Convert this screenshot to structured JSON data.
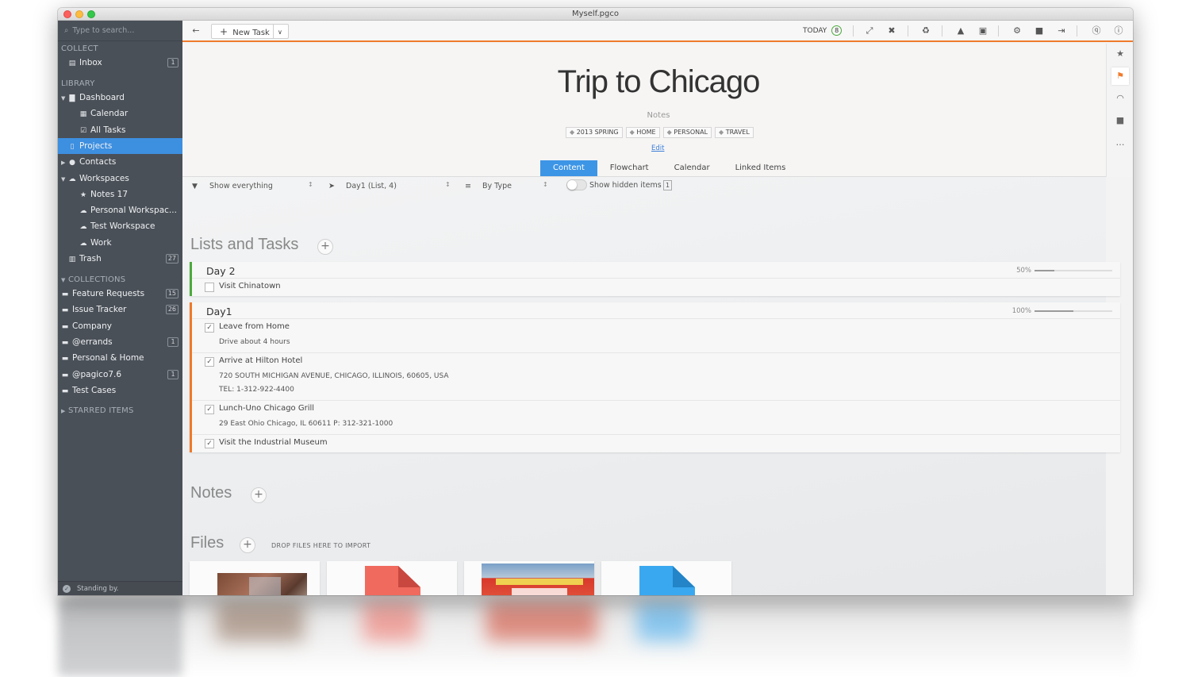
{
  "window": {
    "title": "Myself.pgco"
  },
  "sidebar": {
    "search_placeholder": "Type to search...",
    "collect_header": "COLLECT",
    "library_header": "LIBRARY",
    "collections_header": "COLLECTIONS",
    "starred_header": "STARRED ITEMS",
    "inbox": {
      "label": "Inbox",
      "count": "1"
    },
    "dashboard": "Dashboard",
    "calendar": "Calendar",
    "all_tasks": "All Tasks",
    "projects": "Projects",
    "contacts": "Contacts",
    "workspaces": "Workspaces",
    "notes17": "Notes 17",
    "personal_ws": "Personal Workspac...",
    "test_ws": "Test Workspace",
    "work": "Work",
    "trash": {
      "label": "Trash",
      "count": "27"
    },
    "collections": [
      {
        "label": "Feature Requests",
        "count": "15"
      },
      {
        "label": "Issue Tracker",
        "count": "26"
      },
      {
        "label": "Company",
        "count": ""
      },
      {
        "label": "@errands",
        "count": "1"
      },
      {
        "label": "Personal & Home",
        "count": ""
      },
      {
        "label": "@pagico7.6",
        "count": "1"
      },
      {
        "label": "Test Cases",
        "count": ""
      }
    ],
    "status": "Standing by."
  },
  "toolbar": {
    "new_task": "New Task",
    "today_label": "TODAY",
    "today_count": "8"
  },
  "project": {
    "title": "Trip to Chicago",
    "notes_label": "Notes",
    "tags": [
      "2013 SPRING",
      "HOME",
      "PERSONAL",
      "TRAVEL"
    ],
    "edit": "Edit",
    "tabs": [
      "Content",
      "Flowchart",
      "Calendar",
      "Linked Items"
    ]
  },
  "filters": {
    "show": "Show everything",
    "focus": "Day1 (List, 4)",
    "sort": "By Type",
    "hidden": "Show hidden items",
    "hidden_count": "1"
  },
  "sections": {
    "lists": "Lists and Tasks",
    "notes": "Notes",
    "files": "Files",
    "drop": "DROP FILES HERE TO IMPORT"
  },
  "lists": [
    {
      "title": "Day 2",
      "progress": "50%",
      "progress_value": 0.5,
      "tasks": [
        {
          "name": "Visit Chinatown",
          "done": false,
          "notes": []
        }
      ]
    },
    {
      "title": "Day1",
      "progress": "100%",
      "progress_value": 1.0,
      "tasks": [
        {
          "name": "Leave from Home",
          "done": true,
          "notes": [
            "Drive about 4 hours"
          ]
        },
        {
          "name": "Arrive at Hilton Hotel",
          "done": true,
          "notes": [
            "720 SOUTH MICHIGAN AVENUE, CHICAGO, ILLINOIS, 60605, USA",
            "TEL: 1-312-922-4400"
          ]
        },
        {
          "name": "Lunch-Uno Chicago Grill",
          "done": true,
          "notes": [
            "29 East Ohio Chicago, IL 60611 P: 312-321-1000"
          ]
        },
        {
          "name": "Visit the Industrial Museum",
          "done": true,
          "notes": []
        }
      ]
    }
  ],
  "colors": {
    "accent": "#3d95e6",
    "orange": "#ee7a2a",
    "green": "#4caa3c",
    "sidebar": "#4a5058"
  }
}
